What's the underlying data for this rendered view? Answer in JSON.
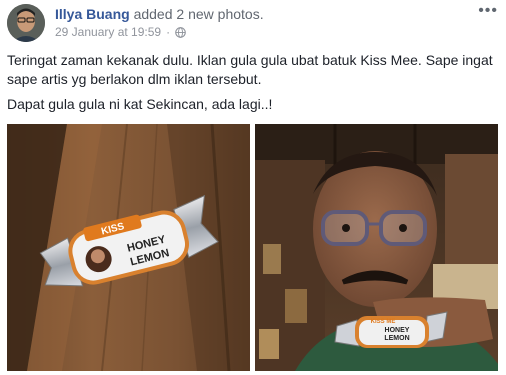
{
  "post": {
    "author": "Illya Buang",
    "action_prefix": "added ",
    "action_link": "2 new photos",
    "action_suffix": ".",
    "timestamp": "29 January at 19:59",
    "separator": "·",
    "menu_label": "•••",
    "text_line1": "Teringat zaman kekanak dulu. Iklan gula gula ubat batuk Kiss Mee. Sape ingat sape artis yg berlakon dlm iklan tersebut.",
    "text_line2": "Dapat gula gula ni kat Sekincan, ada lagi..!"
  },
  "photos": [
    {
      "candy_brand": "KISS",
      "candy_flavor_line1": "HONEY",
      "candy_flavor_line2": "LEMON"
    },
    {
      "candy_brand": "KISS ME",
      "candy_flavor_line1": "HONEY",
      "candy_flavor_line2": "LEMON"
    }
  ],
  "icons": {
    "globe": "globe-icon",
    "menu": "more-options-icon"
  }
}
